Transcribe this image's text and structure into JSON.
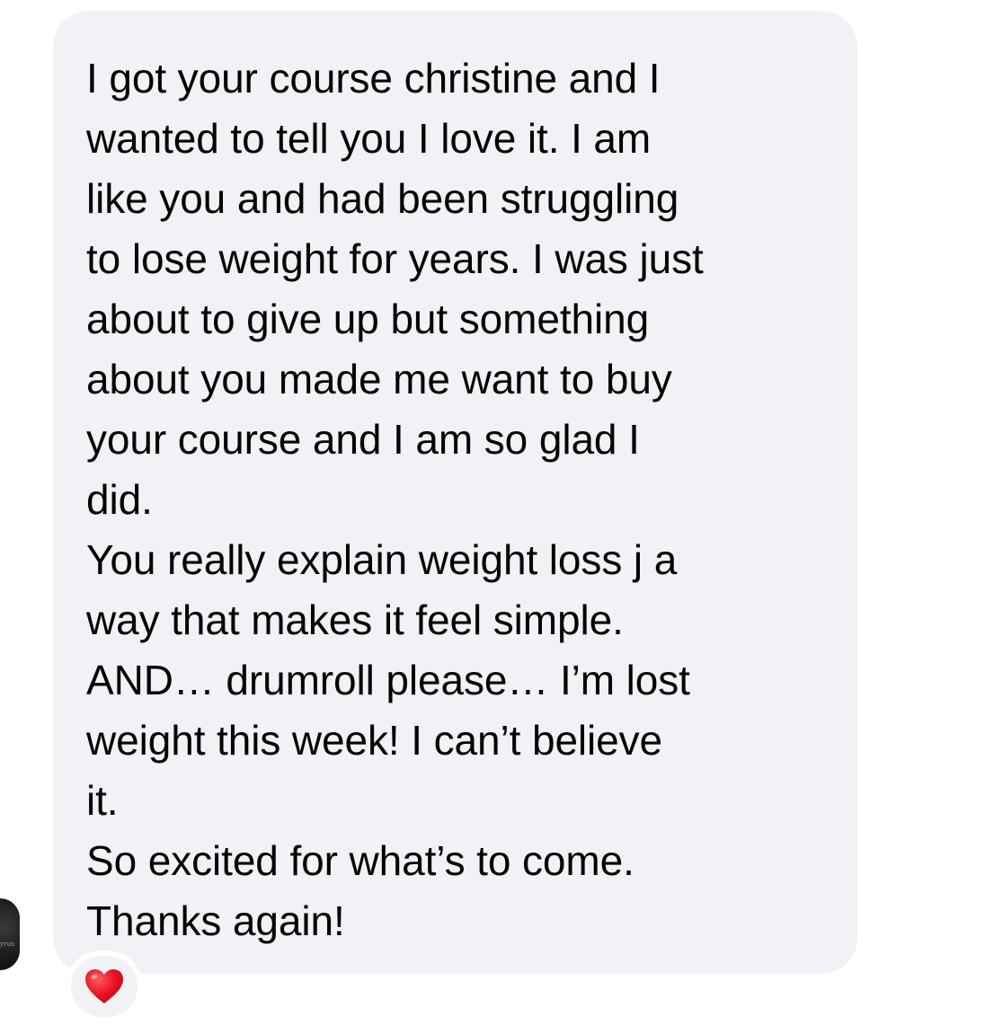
{
  "message": {
    "lines": [
      "I got your course christine and I",
      "wanted to tell you I love it. I am",
      "like you and had been struggling",
      "to lose weight for years. I was just",
      "about to give up but something",
      "about you made me want to buy",
      "your course and I am so glad I",
      "did.",
      "You really explain weight loss j a",
      "way that makes it feel simple.",
      "AND… drumroll please… I’m lost",
      "weight this week! I can’t believe",
      "it.",
      "So excited for what’s to come.",
      "Thanks again!"
    ]
  },
  "sender": {
    "avatar_text": "yrun"
  },
  "reaction": {
    "icon": "red-heart-icon",
    "color": "#e8121f"
  },
  "colors": {
    "bubble": "#f0f2f5",
    "text": "#050505",
    "background": "#ffffff"
  }
}
